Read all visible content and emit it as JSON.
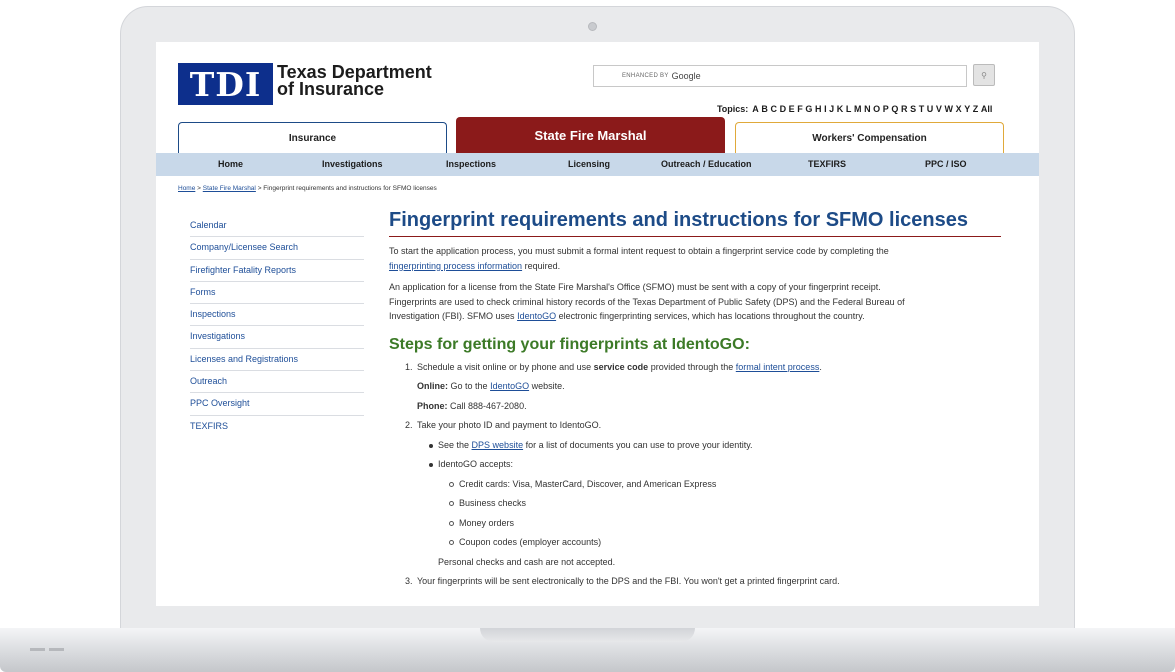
{
  "header": {
    "logo_mark": "TDI",
    "logo_line1": "Texas Department",
    "logo_line2": "of Insurance",
    "search": {
      "enhanced_by": "ENHANCED BY",
      "google": "Google",
      "button_glyph": "⚲"
    },
    "topics_label": "Topics:",
    "topics_letters": [
      "A",
      "B",
      "C",
      "D",
      "E",
      "F",
      "G",
      "H",
      "I",
      "J",
      "K",
      "L",
      "M",
      "N",
      "O",
      "P",
      "Q",
      "R",
      "S",
      "T",
      "U",
      "V",
      "W",
      "X",
      "Y",
      "Z",
      "All"
    ]
  },
  "program_tabs": {
    "insurance": "Insurance",
    "state_fire_marshal": "State Fire Marshal",
    "workers_comp": "Workers' Compensation"
  },
  "nav": {
    "home": "Home",
    "investigations": "Investigations",
    "inspections": "Inspections",
    "licensing": "Licensing",
    "outreach": "Outreach / Education",
    "texfirs": "TEXFIRS",
    "ppc": "PPC / ISO"
  },
  "breadcrumb": {
    "home": "Home",
    "sep": ">",
    "sfm": "State Fire Marshal",
    "current": "Fingerprint requirements and instructions for SFMO licenses"
  },
  "sidebar": {
    "items": [
      "Calendar",
      "Company/Licensee Search",
      "Firefighter Fatality Reports",
      "Forms",
      "Inspections",
      "Investigations",
      "Licenses and Registrations",
      "Outreach",
      "PPC Oversight",
      "TEXFIRS"
    ]
  },
  "main": {
    "title": "Fingerprint requirements and instructions for SFMO licenses",
    "p1_a": "To start the application process, you must submit a formal intent request to obtain a fingerprint service code by completing the",
    "p1_link": "fingerprinting process information",
    "p1_b": "required.",
    "p2_a": "An application for a license from the State Fire Marshal's Office (SFMO) must be sent with a copy of your fingerprint receipt.",
    "p2_b": "Fingerprints are used to check criminal history records of the Texas Department of Public Safety (DPS) and the Federal Bureau of",
    "p2_c": "Investigation (FBI). SFMO uses",
    "p2_link": "IdentoGO",
    "p2_d": "electronic fingerprinting services, which has locations throughout the country.",
    "h2": "Steps for getting your fingerprints at IdentoGO:",
    "step1": {
      "num": "1.",
      "a": "Schedule a visit online or by phone and use",
      "bold": "service code",
      "b": "provided through the",
      "link": "formal intent process",
      "c": "."
    },
    "online": {
      "label": "Online:",
      "a": "Go to the",
      "link": "IdentoGO",
      "b": "website."
    },
    "phone": {
      "label": "Phone:",
      "text": "Call 888-467-2080."
    },
    "step2": {
      "num": "2.",
      "text": "Take your photo ID and payment to IdentoGO."
    },
    "bullet1": {
      "a": "See the",
      "link": "DPS website",
      "b": "for a list of documents you can use to prove your identity."
    },
    "bullet2": "IdentoGO accepts:",
    "accepts": [
      "Credit cards: Visa, MasterCard, Discover, and American Express",
      "Business checks",
      "Money orders",
      "Coupon codes (employer accounts)"
    ],
    "not_accepted": "Personal checks and cash are not accepted.",
    "step3": {
      "num": "3.",
      "text": "Your fingerprints will be sent electronically to the DPS and the FBI. You won't get a printed fingerprint card."
    }
  }
}
